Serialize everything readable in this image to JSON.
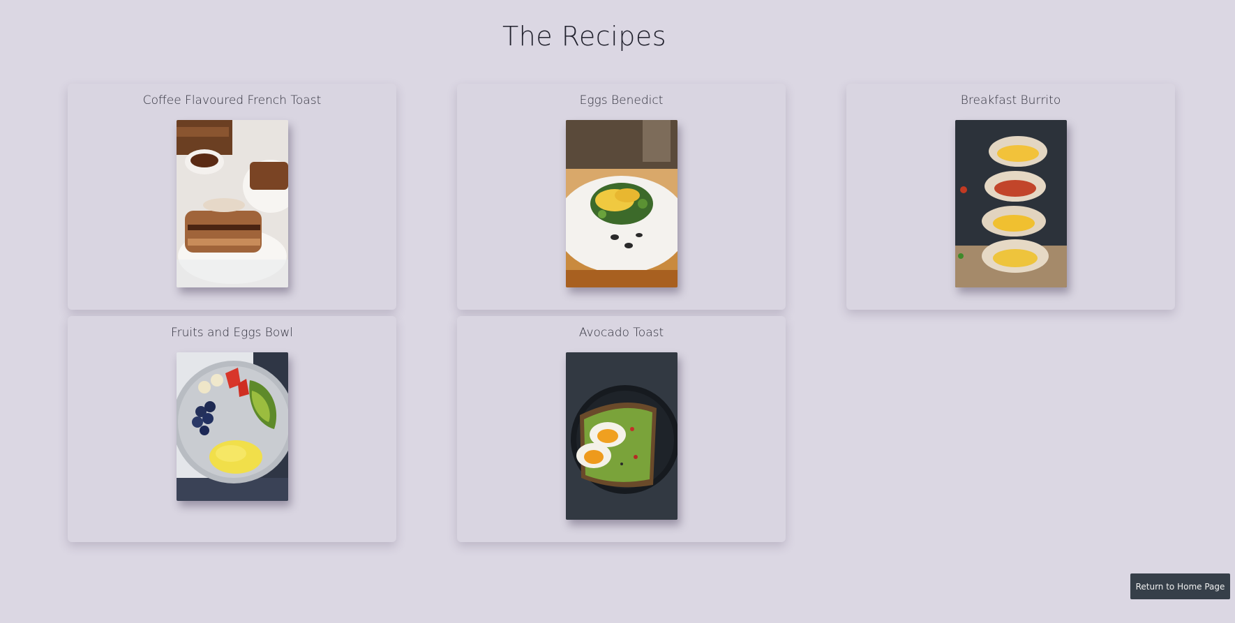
{
  "page": {
    "title": "The Recipes"
  },
  "recipes": [
    {
      "name": "Coffee Flavoured French Toast",
      "image_icon": "french-toast-photo"
    },
    {
      "name": "Eggs Benedict",
      "image_icon": "eggs-benedict-photo"
    },
    {
      "name": "Breakfast Burrito",
      "image_icon": "breakfast-burrito-photo"
    },
    {
      "name": "Fruits and Eggs Bowl",
      "image_icon": "fruits-eggs-bowl-photo"
    },
    {
      "name": "Avocado Toast",
      "image_icon": "avocado-toast-photo"
    }
  ],
  "footer": {
    "home_button_label": "Return to Home Page"
  },
  "colors": {
    "background": "#dbd7e3",
    "card": "#d9d5e1",
    "button": "#363f49"
  }
}
